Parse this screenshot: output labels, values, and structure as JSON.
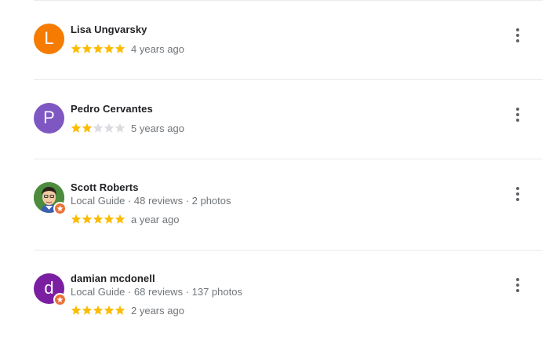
{
  "reviews": [
    {
      "author": "Lisa Ungvarsky",
      "avatar_letter": "L",
      "avatar_color": "#f57c00",
      "local_guide_line": "",
      "rating": 5,
      "time": "4 years ago",
      "more_icon": "more-vert-icon"
    },
    {
      "author": "Pedro Cervantes",
      "avatar_letter": "P",
      "avatar_color": "#7e57c2",
      "local_guide_line": "",
      "rating": 2,
      "time": "5 years ago",
      "more_icon": "more-vert-icon"
    },
    {
      "author": "Scott Roberts",
      "avatar_letter": "",
      "avatar_color": "#3f7d3a",
      "local_guide_line": "Local Guide · 48 reviews · 2 photos",
      "rating": 5,
      "time": "a year ago",
      "more_icon": "more-vert-icon"
    },
    {
      "author": "damian mcdonell",
      "avatar_letter": "d",
      "avatar_color": "#7b1fa2",
      "local_guide_line": "Local Guide · 68 reviews · 137 photos",
      "rating": 5,
      "time": "2 years ago",
      "more_icon": "more-vert-icon"
    }
  ],
  "colors": {
    "star_filled": "#fbbc04",
    "star_empty": "#dadce0",
    "local_guide_badge": "#ea7038",
    "divider": "#ebebeb"
  }
}
